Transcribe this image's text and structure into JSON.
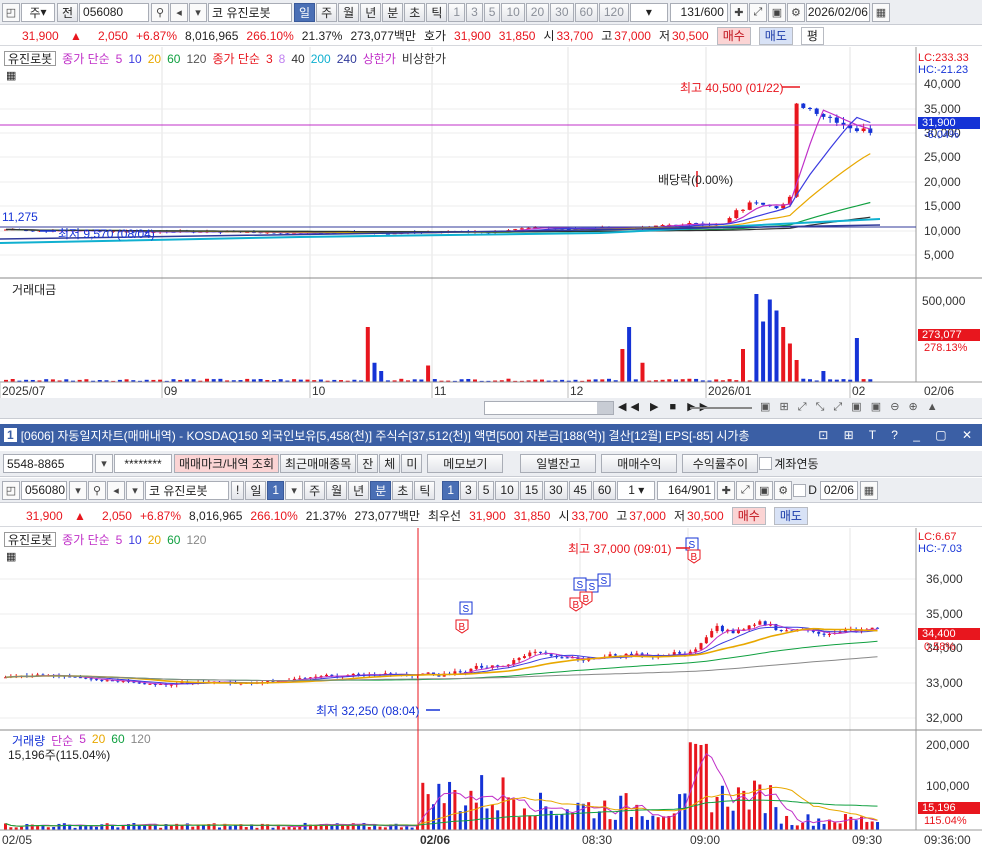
{
  "top": {
    "toolbar": {
      "type_label": "주",
      "prev_label": "전",
      "code": "056080",
      "market": "코",
      "name": "유진로봇",
      "periods": [
        "일",
        "주",
        "월",
        "년",
        "분",
        "초",
        "틱"
      ],
      "numbers": [
        "1",
        "3",
        "5",
        "10",
        "20",
        "30",
        "60",
        "120"
      ],
      "count": "131",
      "total": "/600",
      "date": "2026/02/06"
    },
    "quote": {
      "price": "31,900",
      "arrow": "▲",
      "change": "2,050",
      "rate": "+6.87%",
      "volume": "8,016,965",
      "vol_ratio": "266.10%",
      "turnover": "21.37%",
      "amount": "273,077백만",
      "ask_label": "호가",
      "ask1": "31,900",
      "ask2": "31,850",
      "open_label": "시",
      "open": "33,700",
      "high_label": "고",
      "high": "37,000",
      "low_label": "저",
      "low": "30,500",
      "buy": "매수",
      "sell": "매도",
      "avg": "평"
    },
    "legend": {
      "name": "유진로봇",
      "ma1": "종가 단순",
      "ma1_vals": [
        "5",
        "10",
        "20",
        "60",
        "120"
      ],
      "ma2": "종가 단순",
      "ma2_vals": [
        "3",
        "8",
        "40",
        "200",
        "240"
      ],
      "upper": "상한가",
      "lower": "비상한가"
    },
    "annotations": {
      "high": "최고 40,500 (01/22)",
      "low": "최저 9,570 (08/04)",
      "div": "배당락(0.00%)",
      "level": "11,275",
      "lc": "LC:233.33",
      "hc": "HC:-21.23",
      "cur_price": "31,900",
      "cur_rate": "-6.04%"
    },
    "price_axis": [
      "40,000",
      "35,000",
      "30,000",
      "25,000",
      "20,000",
      "15,000",
      "10,000",
      "5,000"
    ],
    "volume_title": "거래대금",
    "volume_axis": [
      "500,000"
    ],
    "vol_cur": "273,077",
    "vol_rate": "278.13%",
    "x_axis": [
      "2025/07",
      "09",
      "10",
      "11",
      "12",
      "2026/01",
      "02",
      "02/06"
    ]
  },
  "window": {
    "title": "[0606] 자동일지차트(매매내역) - KOSDAQ150 외국인보유[5,458(천)] 주식수[37,512(천)] 액면[500] 자본금[188(억)] 결산[12월] EPS[-85] 시가총",
    "num": "1"
  },
  "bottom": {
    "account": "5548-8865",
    "password": "********",
    "tabs": [
      "매매마크/내역 조회",
      "최근매매종목",
      "잔",
      "체",
      "미",
      "메모보기",
      "일별잔고",
      "매매수익",
      "수익률추이"
    ],
    "account_link": "계좌연동",
    "toolbar": {
      "code": "056080",
      "market": "코",
      "name": "유진로봇",
      "excl": "!",
      "period": "일",
      "num": "1",
      "periods": [
        "주",
        "월",
        "년",
        "분",
        "초",
        "틱"
      ],
      "numbers": [
        "1",
        "3",
        "5",
        "10",
        "15",
        "30",
        "45",
        "60"
      ],
      "interval": "1",
      "count": "164",
      "total": "/901",
      "d_label": "D",
      "date": "02/06"
    },
    "quote": {
      "price": "31,900",
      "arrow": "▲",
      "change": "2,050",
      "rate": "+6.87%",
      "volume": "8,016,965",
      "vol_ratio": "266.10%",
      "turnover": "21.37%",
      "amount": "273,077백만",
      "ask_label": "최우선",
      "ask1": "31,900",
      "ask2": "31,850",
      "open_label": "시",
      "open": "33,700",
      "high_label": "고",
      "high": "37,000",
      "low_label": "저",
      "low": "30,500",
      "buy": "매수",
      "sell": "매도"
    },
    "legend": {
      "name": "유진로봇",
      "ma": "종가 단순",
      "ma_vals": [
        "5",
        "10",
        "20",
        "60",
        "120"
      ]
    },
    "annotations": {
      "high": "최고 37,000 (09:01)",
      "low": "최저 32,250 (08:04)",
      "lc": "LC:6.67",
      "hc": "HC:-7.03",
      "cur_price": "34,400",
      "cur_rate": "0.58%"
    },
    "price_axis": [
      "36,000",
      "35,000",
      "34,000",
      "33,000",
      "32,000"
    ],
    "volume_legend": {
      "title": "거래량",
      "ma": "단순",
      "vals": [
        "5",
        "20",
        "60",
        "120"
      ],
      "summary": "15,196주(115.04%)"
    },
    "volume_axis": [
      "200,000",
      "100,000"
    ],
    "vol_cur": "15,196",
    "vol_rate": "115.04%",
    "x_axis": [
      "02/05",
      "02/06",
      "08:30",
      "09:00",
      "09:30",
      "09:36:00"
    ]
  },
  "colors": {
    "up": "#e8161e",
    "down": "#1533d6",
    "ma5": "#c030c8",
    "ma10": "#3b3be0",
    "ma20": "#e8a800",
    "ma60": "#10a040",
    "ma120": "#303030"
  }
}
